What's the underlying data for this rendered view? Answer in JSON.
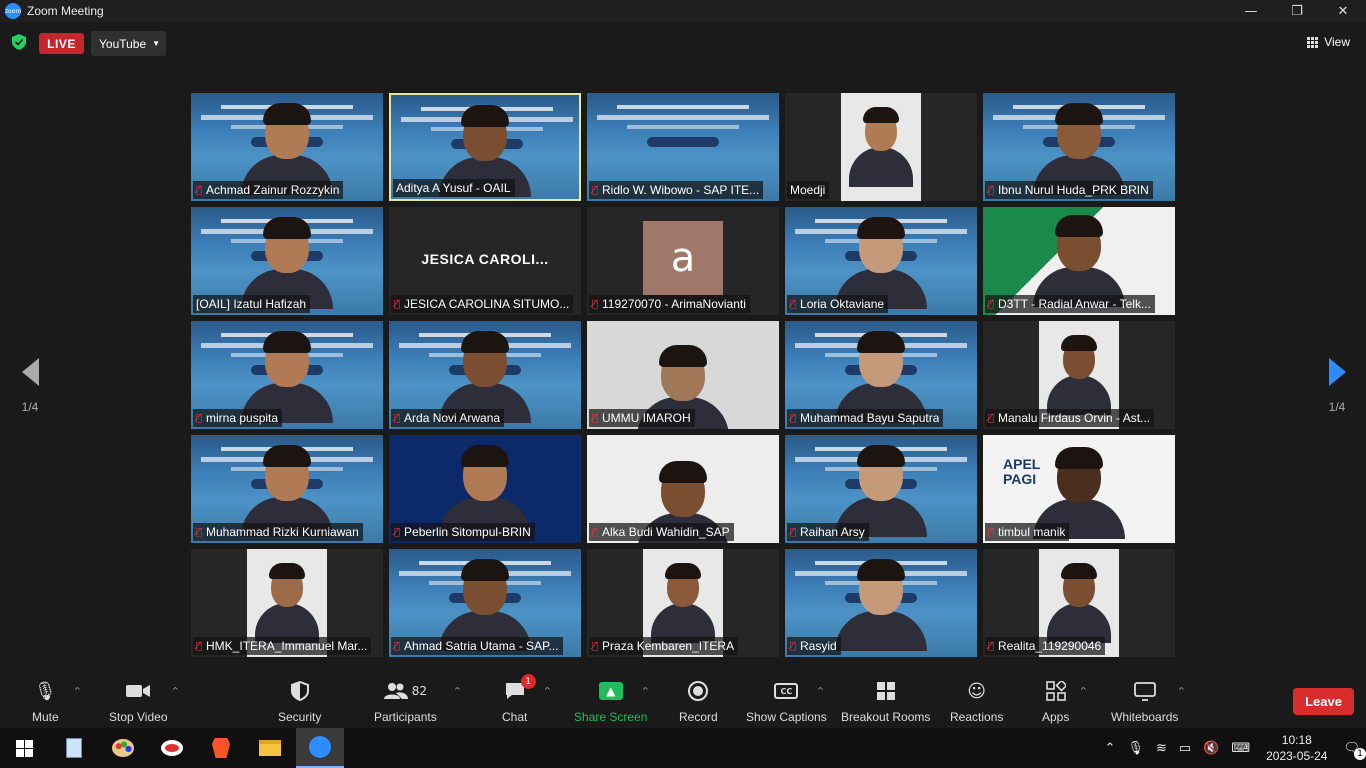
{
  "window": {
    "title": "Zoom Meeting",
    "controls": [
      "—",
      "❐",
      "✕"
    ]
  },
  "topbar": {
    "live_label": "LIVE",
    "stream_target": "YouTube",
    "view_label": "View"
  },
  "pager": {
    "left": "1/4",
    "right": "1/4"
  },
  "participants": [
    {
      "name": "Achmad Zainur Rozzykin",
      "muted": true
    },
    {
      "name": "Aditya A Yusuf - OAIL",
      "muted": false
    },
    {
      "name": "Ridlo W. Wibowo - SAP ITE...",
      "muted": true
    },
    {
      "name": "Moedji",
      "muted": false
    },
    {
      "name": "Ibnu Nurul Huda_PRK BRIN",
      "muted": true
    },
    {
      "name": "[OAIL] Izatul Hafizah",
      "muted": false
    },
    {
      "name": "JESICA CAROLINA SITUMO...",
      "muted": true,
      "big": "JESICA  CAROLI..."
    },
    {
      "name": "119270070 - ArimaNovianti",
      "muted": true,
      "avatar": "a"
    },
    {
      "name": "Loria Oktaviane",
      "muted": true
    },
    {
      "name": "D3TT - Radial Anwar - Telk...",
      "muted": true
    },
    {
      "name": "mirna puspita",
      "muted": true
    },
    {
      "name": "Arda Novi Arwana",
      "muted": true
    },
    {
      "name": "UMMU IMAROH",
      "muted": true
    },
    {
      "name": "Muhammad Bayu Saputra",
      "muted": true
    },
    {
      "name": "Manalu  Firdaus Orvin - Ast...",
      "muted": true
    },
    {
      "name": "Muhammad Rizki Kurniawan",
      "muted": true
    },
    {
      "name": "Peberlin Sitompul-BRIN",
      "muted": true
    },
    {
      "name": "Alka Budi Wahidin_SAP",
      "muted": true
    },
    {
      "name": "Raihan Arsy",
      "muted": true
    },
    {
      "name": "timbul manik",
      "muted": true
    },
    {
      "name": "HMK_ITERA_Immanuel Mar...",
      "muted": true
    },
    {
      "name": "Ahmad Satria Utama - SAP...",
      "muted": true
    },
    {
      "name": "Praza Kembaren_ITERA",
      "muted": true
    },
    {
      "name": "Rasyid",
      "muted": true
    },
    {
      "name": "Realita_119290046",
      "muted": true
    }
  ],
  "apel": {
    "line1": "APEL",
    "line2": "PAGI"
  },
  "toolbar": {
    "mute": "Mute",
    "stop_video": "Stop Video",
    "security": "Security",
    "participants": "Participants",
    "participants_count": "82",
    "chat": "Chat",
    "chat_badge": "1",
    "share_screen": "Share Screen",
    "record": "Record",
    "captions": "Show Captions",
    "breakout": "Breakout Rooms",
    "reactions": "Reactions",
    "apps": "Apps",
    "whiteboards": "Whiteboards",
    "leave": "Leave"
  },
  "taskbar": {
    "time": "10:18",
    "date": "2023-05-24",
    "notifications": "1"
  },
  "colors": {
    "accent": "#2d8cff",
    "live": "#c6262e",
    "share": "#1fbd5c",
    "leave": "#d92d2d"
  }
}
